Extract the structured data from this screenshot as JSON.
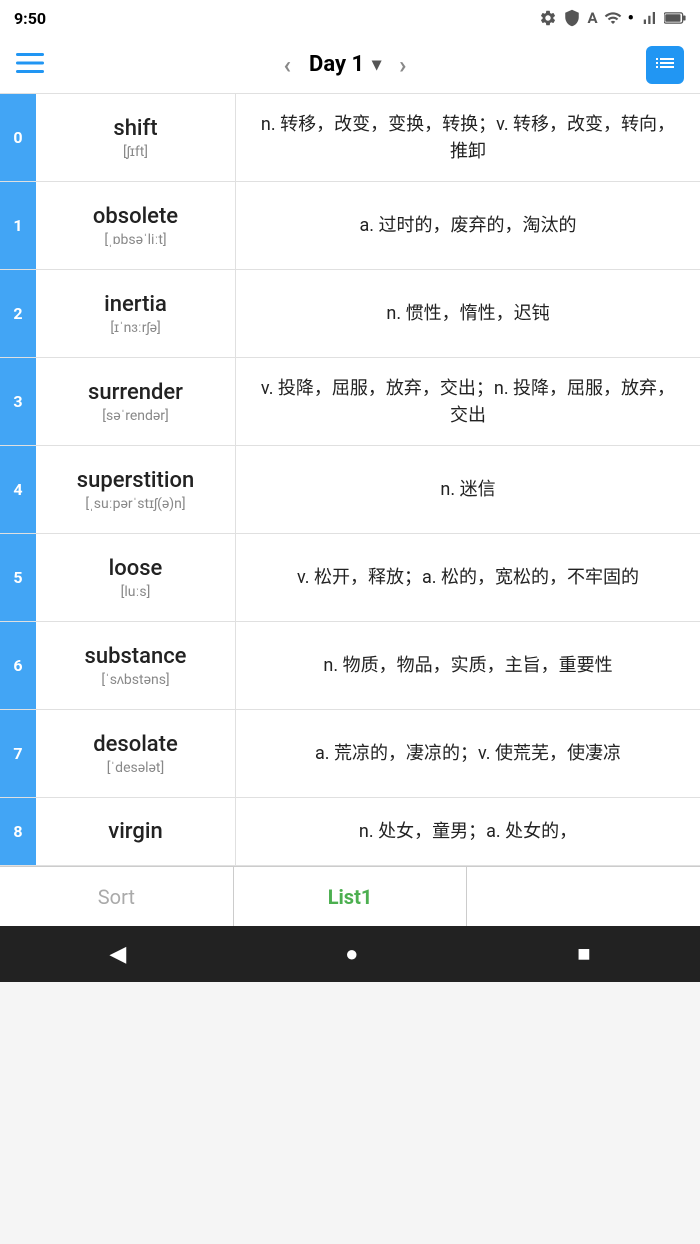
{
  "statusBar": {
    "time": "9:50",
    "icons": [
      "settings",
      "shield",
      "accessibility",
      "wifi",
      "dot",
      "signal",
      "battery"
    ]
  },
  "toolbar": {
    "prevLabel": "‹",
    "nextLabel": "›",
    "dayTitle": "Day 1",
    "dropdownIcon": "▾"
  },
  "words": [
    {
      "index": "0",
      "word": "shift",
      "phonetic": "[ʃɪft]",
      "definition": "n. 转移，改变，变换，转换；v. 转移，改变，转向，推卸"
    },
    {
      "index": "1",
      "word": "obsolete",
      "phonetic": "[ˌɒbsəˈliːt]",
      "definition": "a. 过时的，废弃的，淘汰的"
    },
    {
      "index": "2",
      "word": "inertia",
      "phonetic": "[ɪˈnɜːrʃə]",
      "definition": "n. 惯性，惰性，迟钝"
    },
    {
      "index": "3",
      "word": "surrender",
      "phonetic": "[səˈrendər]",
      "definition": "v. 投降，屈服，放弃，交出；n. 投降，屈服，放弃，交出"
    },
    {
      "index": "4",
      "word": "superstition",
      "phonetic": "[ˌsuːpərˈstɪʃ(ə)n]",
      "definition": "n. 迷信"
    },
    {
      "index": "5",
      "word": "loose",
      "phonetic": "[luːs]",
      "definition": "v. 松开，释放；a. 松的，宽松的，不牢固的"
    },
    {
      "index": "6",
      "word": "substance",
      "phonetic": "[ˈsʌbstəns]",
      "definition": "n. 物质，物品，实质，主旨，重要性"
    },
    {
      "index": "7",
      "word": "desolate",
      "phonetic": "[ˈdesələt]",
      "definition": "a. 荒凉的，凄凉的；v. 使荒芜，使凄凉"
    },
    {
      "index": "8",
      "word": "virgin",
      "phonetic": "",
      "definition": "n. 处女，童男；a. 处女的，"
    }
  ],
  "bottomTabs": {
    "sort": "Sort",
    "list1": "List1"
  },
  "navBar": {
    "back": "◀",
    "home": "●",
    "recent": "■"
  }
}
